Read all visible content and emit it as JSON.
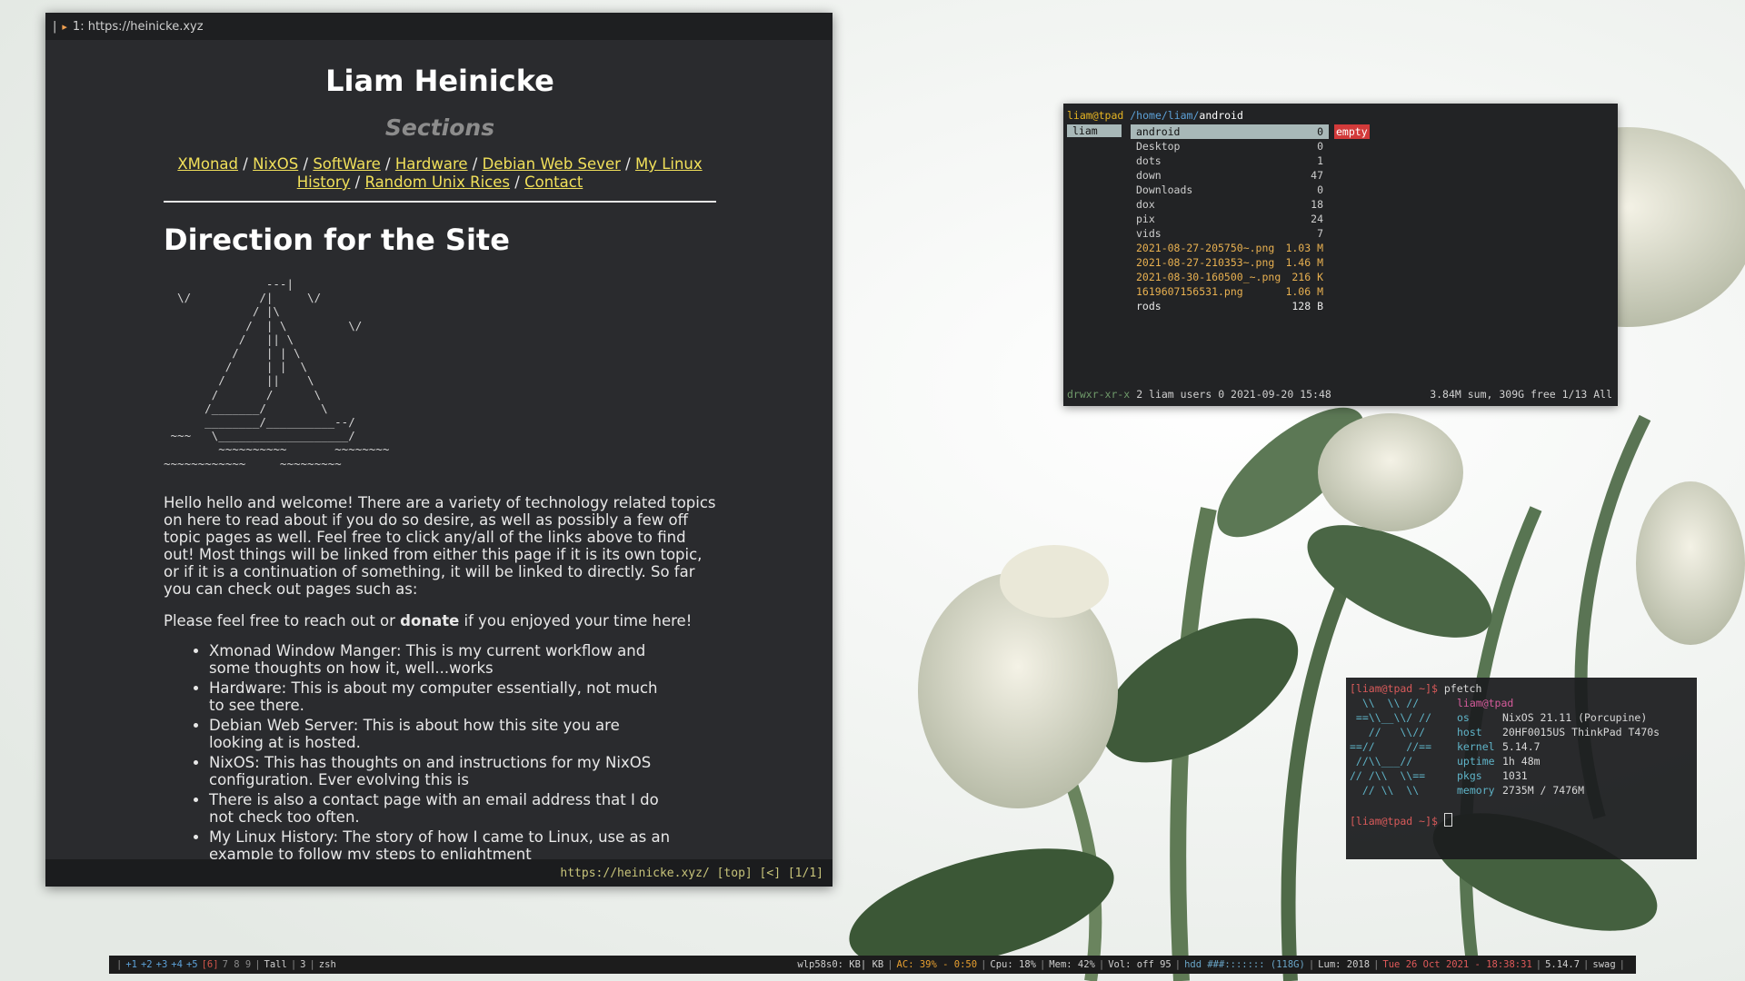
{
  "browser": {
    "tab_label": "1: https://heinicke.xyz",
    "site_title": "Liam Heinicke",
    "sections_heading": "Sections",
    "nav_links": [
      "XMonad",
      "NixOS",
      "SoftWare",
      "Hardware",
      "Debian Web Sever",
      "My Linux History",
      "Random Unix Rices",
      "Contact"
    ],
    "nav_separator": " / ",
    "page_heading": "Direction for the Site",
    "ascii_art": "               ---|\n  \\/          /|     \\/\n             / |\\\n            /  | \\         \\/\n           /   || \\\n          /    | | \\\n         /     | |  \\\n        /      ||    \\\n       /       /      \\\n      /_______/        \\\n      ________/__________--/\n ~~~   \\___________________/\n        ~~~~~~~~~~       ~~~~~~~~\n~~~~~~~~~~~~     ~~~~~~~~~",
    "intro_paragraph": "Hello hello and welcome! There are a variety of technology related topics on here to read about if you do so desire, as well as possibly a few off topic pages as well. Feel free to click any/all of the links above to find out! Most things will be linked from either this page if it is its own topic, or if it is a continuation of something, it will be linked to directly. So far you can check out pages such as:",
    "donate_before": "Please feel free to reach out or ",
    "donate_bold": "donate",
    "donate_after": " if you enjoyed your time here!",
    "list_items": [
      "Xmonad Window Manger: This is my current workflow and some thoughts on how it, well...works",
      "Hardware: This is about my computer essentially, not much to see there.",
      "Debian Web Server: This is about how this site you are looking at is hosted.",
      "NixOS: This has thoughts on and instructions for my NixOS configuration. Ever evolving this is",
      "There is also a contact page with an email address that I do not check too often.",
      "My Linux History: The story of how I came to Linux, use as an example to follow my steps to enlightment"
    ],
    "status_line": "https://heinicke.xyz/ [top] [<] [1/1]"
  },
  "file_manager": {
    "user_host": "liam@tpad",
    "path_prefix": "/home/liam/",
    "current_dir": "android",
    "parent_entry": "liam",
    "empty_label": "empty",
    "entries": [
      {
        "name": "android",
        "size": "0",
        "kind": "sel"
      },
      {
        "name": "Desktop",
        "size": "0",
        "kind": "dirrow"
      },
      {
        "name": "dots",
        "size": "1",
        "kind": "dirrow"
      },
      {
        "name": "down",
        "size": "47",
        "kind": "dirrow"
      },
      {
        "name": "Downloads",
        "size": "0",
        "kind": "dirrow"
      },
      {
        "name": "dox",
        "size": "18",
        "kind": "dirrow"
      },
      {
        "name": "pix",
        "size": "24",
        "kind": "dirrow"
      },
      {
        "name": "vids",
        "size": "7",
        "kind": "dirrow"
      },
      {
        "name": "2021-08-27-205750~.png",
        "size": "1.03 M",
        "kind": "file"
      },
      {
        "name": "2021-08-27-210353~.png",
        "size": "1.46 M",
        "kind": "file"
      },
      {
        "name": "2021-08-30-160500_~.png",
        "size": "216 K",
        "kind": "file"
      },
      {
        "name": "1619607156531.png",
        "size": "1.06 M",
        "kind": "file"
      },
      {
        "name": "rods",
        "size": "128 B",
        "kind": "plain"
      }
    ],
    "status_perms": "drwxr-xr-x",
    "status_info": "2 liam users 0 2021-09-20 15:48",
    "status_right": "3.84M sum, 309G free  1/13  All"
  },
  "terminal": {
    "prompt1": "[liam@tpad ~]$ ",
    "command": "pfetch",
    "logo_lines": [
      "  \\\\  \\\\ //",
      " ==\\\\__\\\\/ //",
      "   //   \\\\//",
      "==//     //==",
      " //\\\\___//",
      "// /\\\\  \\\\==",
      "  // \\\\  \\\\"
    ],
    "fetch_title": "liam@tpad",
    "fetch_rows": [
      {
        "key": "os",
        "value": "NixOS 21.11 (Porcupine)"
      },
      {
        "key": "host",
        "value": "20HF0015US ThinkPad T470s"
      },
      {
        "key": "kernel",
        "value": "5.14.7"
      },
      {
        "key": "uptime",
        "value": "1h 48m"
      },
      {
        "key": "pkgs",
        "value": "1031"
      },
      {
        "key": "memory",
        "value": "2735M / 7476M"
      }
    ],
    "prompt2": "[liam@tpad ~]$ "
  },
  "statusbar": {
    "workspaces": [
      "+1",
      "+2",
      "+3",
      "+4",
      "+5"
    ],
    "current_ws": "[6]",
    "other_ws": "7 8 9",
    "layout": "Tall",
    "window_count": "3",
    "window_title": "zsh",
    "net": "wlp58s0: KB| KB",
    "ac": "AC: 39% - 0:50",
    "cpu": "Cpu: 18%",
    "mem": "Mem: 42%",
    "vol": "Vol: off 95",
    "hdd": "hdd ###::::::: (118G)",
    "lum": "Lum: 2018",
    "date": "Tue 26 Oct 2021 - 18:38:31",
    "kernel": "5.14.7",
    "user": "swag"
  },
  "colors": {
    "accent_link": "#f1e05a",
    "selection": "#a8b8b8",
    "prompt": "#d85a5a",
    "fetch_key": "#5fb4c8"
  }
}
